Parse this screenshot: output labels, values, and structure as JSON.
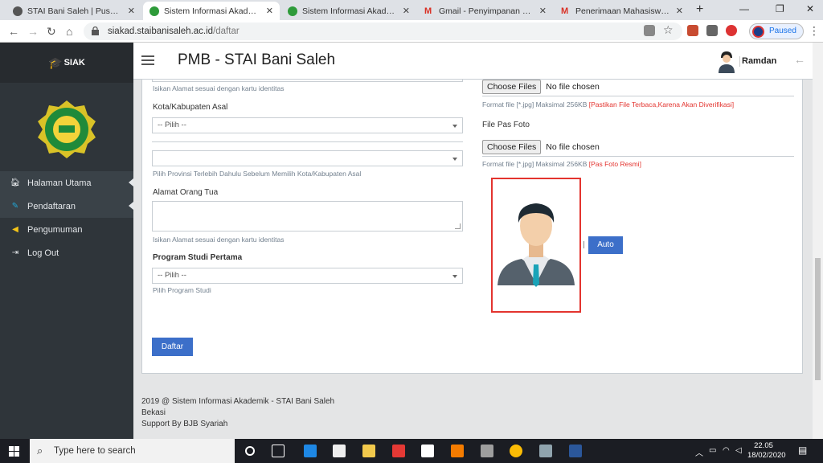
{
  "browser": {
    "tabs": [
      {
        "title": "STAI Bani Saleh | Pusat Inovasi"
      },
      {
        "title": "Sistem Informasi Akademik - S"
      },
      {
        "title": "Sistem Informasi Akademik - S"
      },
      {
        "title": "Gmail - Penyimpanan dan Ema"
      },
      {
        "title": "Penerimaan Mahasiswa Baru [I"
      }
    ],
    "url_host": "siakad.staibanisaleh.ac.id",
    "url_path": "/daftar",
    "paused_label": "Paused"
  },
  "app": {
    "brand": "SIAK",
    "page_title": "PMB - STAI Bani Saleh",
    "user_name": "Ramdan",
    "menu": [
      {
        "label": "Halaman Utama",
        "icon": "home-icon"
      },
      {
        "label": "Pendaftaran",
        "icon": "edit-icon"
      },
      {
        "label": "Pengumuman",
        "icon": "megaphone-icon"
      },
      {
        "label": "Log Out",
        "icon": "logout-icon"
      }
    ]
  },
  "form": {
    "address_help": "Isikan Alamat sesuai dengan kartu identitas",
    "city_label": "Kota/Kabupaten Asal",
    "city_value": "-- Pilih --",
    "province_value": "",
    "province_help": "Pilih Provinsi Terlebih Dahulu Sebelum Memilih Kota/Kabupaten Asal",
    "parent_address_label": "Alamat Orang Tua",
    "parent_address_help": "Isikan Alamat sesuai dengan kartu identitas",
    "program_label": "Program Studi Pertama",
    "program_value": "-- Pilih --",
    "program_help": "Pilih Program Studi",
    "submit_label": "Daftar",
    "file1_button": "Choose Files",
    "file1_status": "No file chosen",
    "file1_help": "Format file [*.jpg] Maksimal 256KB ",
    "file1_note": "[Pastikan File Terbaca,Karena Akan Diverifikasi]",
    "photo_label": "File Pas Foto",
    "file2_button": "Choose Files",
    "file2_status": "No file chosen",
    "file2_help": "Format file [*.jpg] Maksimal 256KB ",
    "file2_note": "[Pas Foto Resmi]",
    "auto_label": "Auto"
  },
  "footer": {
    "line1": "2019 @ Sistem Informasi Akademik - STAI Bani Saleh",
    "line2": "Bekasi",
    "line3": "Support By BJB Syariah"
  },
  "taskbar": {
    "search_placeholder": "Type here to search",
    "time": "22.05",
    "date": "18/02/2020"
  },
  "colors": {
    "sidebar": "#2f353a",
    "accent": "#3c6fc9",
    "alert": "#e3342f"
  }
}
